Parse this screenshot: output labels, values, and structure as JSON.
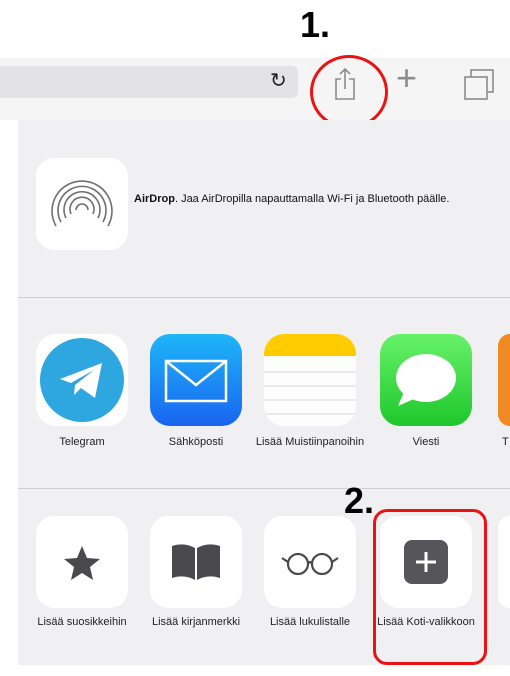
{
  "annotations": {
    "step1": "1.",
    "step2": "2."
  },
  "airdrop": {
    "title": "AirDrop",
    "description": ". Jaa AirDropilla napauttamalla Wi-Fi ja Bluetooth päälle."
  },
  "apps": [
    {
      "label": "Telegram",
      "icon": "telegram-icon"
    },
    {
      "label": "Sähköposti",
      "icon": "mail-icon"
    },
    {
      "label": "Lisää Muistiinpanoihin",
      "icon": "notes-icon"
    },
    {
      "label": "Viesti",
      "icon": "messages-icon"
    },
    {
      "label": "T",
      "icon": "partial-app-icon"
    }
  ],
  "actions": [
    {
      "label": "Lisää suosikkeihin",
      "icon": "star-icon"
    },
    {
      "label": "Lisää kirjanmerkki",
      "icon": "book-icon"
    },
    {
      "label": "Lisää lukulistalle",
      "icon": "glasses-icon"
    },
    {
      "label": "Lisää Koti-valikkoon",
      "icon": "add-home-icon"
    }
  ],
  "colors": {
    "annotation": "#e11111",
    "telegram": "#2ea6df",
    "mail": "#1f7cf3",
    "messages": "#4cd964",
    "notes": "#ffcc00"
  }
}
